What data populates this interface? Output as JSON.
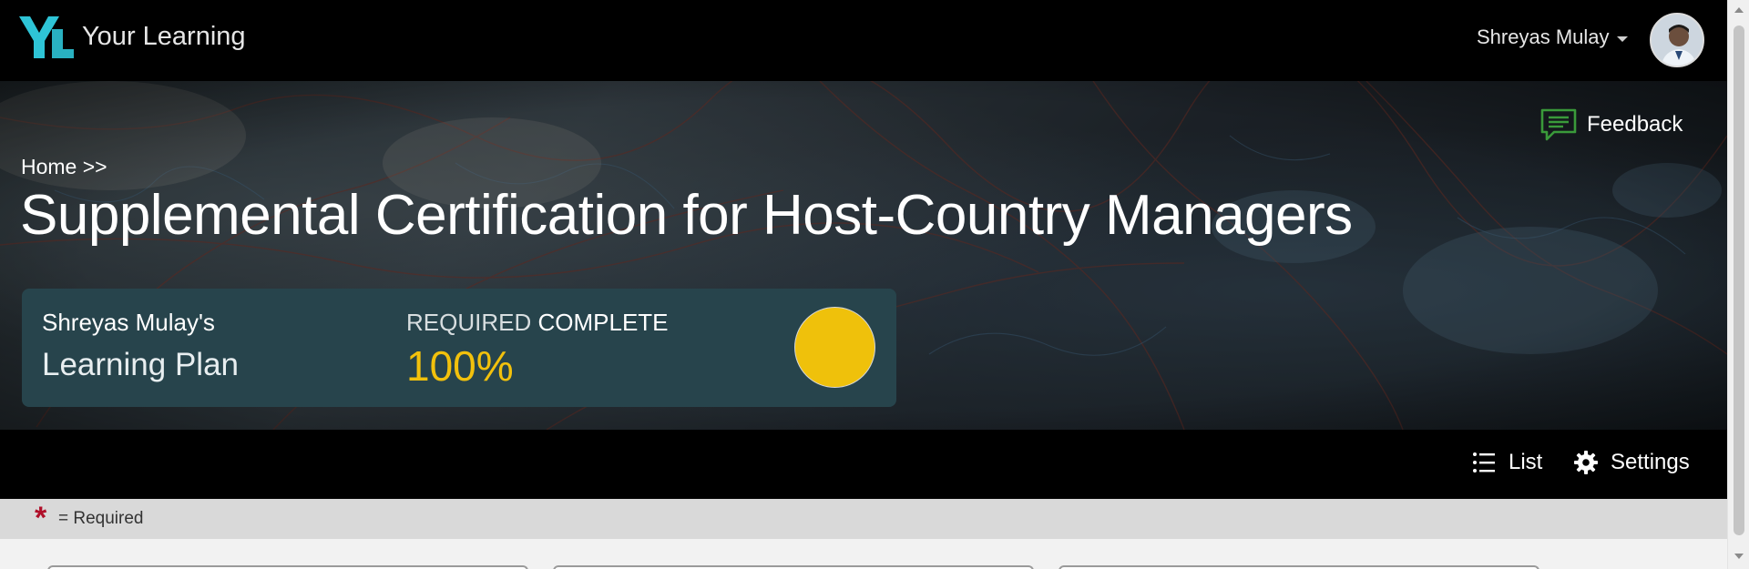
{
  "app": {
    "logo_text": "YL",
    "title": "Your Learning"
  },
  "user": {
    "name": "Shreyas Mulay"
  },
  "hero": {
    "feedback_label": "Feedback",
    "breadcrumb": "Home >>",
    "page_title": "Supplemental Certification for Host-Country Managers"
  },
  "plan_card": {
    "owner": "Shreyas Mulay's",
    "plan_name": "Learning Plan",
    "status_prefix": "REQUIRED",
    "status_word": "COMPLETE",
    "percent_text": "100%",
    "progress_fraction": 1.0
  },
  "toolbar": {
    "list_label": "List",
    "settings_label": "Settings"
  },
  "legend": {
    "symbol": "*",
    "text": "= Required"
  },
  "colors": {
    "accent_yellow": "#efc10b",
    "card_bg": "#27444c",
    "required_red": "#b0102a",
    "feedback_green": "#3a9a3a",
    "logo_teal": "#2ec4d6"
  },
  "icons": {
    "logo": "yl-logo",
    "caret": "caret-down-icon",
    "feedback": "chat-bubble-icon",
    "list": "list-icon",
    "settings": "gear-icon"
  }
}
